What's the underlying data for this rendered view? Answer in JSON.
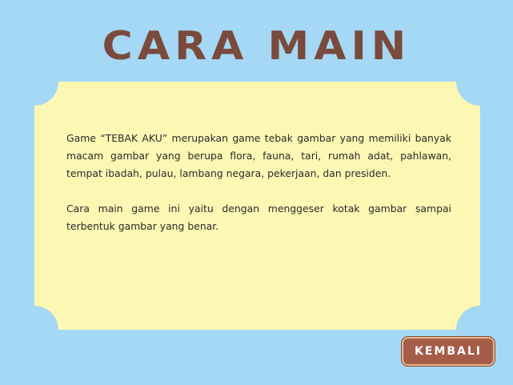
{
  "header": {
    "title": "CARA MAIN"
  },
  "instructions": {
    "paragraph_1": "Game “TEBAK AKU” merupakan game tebak gambar yang memiliki banyak macam gambar yang berupa flora, fauna,  tari,  rumah adat, pahlawan, tempat ibadah,  pulau, lambang negara, pekerjaan, dan presiden.",
    "paragraph_2": "Cara main game ini yaitu dengan menggeser kotak gambar sampai terbentuk gambar yang benar."
  },
  "footer": {
    "back_label": "KEMBALI"
  },
  "colors": {
    "background": "#a5d8f5",
    "card": "#fdf7b4",
    "title": "#7a4a3c",
    "button": "#a55c48",
    "button_border": "#e7b78a"
  }
}
